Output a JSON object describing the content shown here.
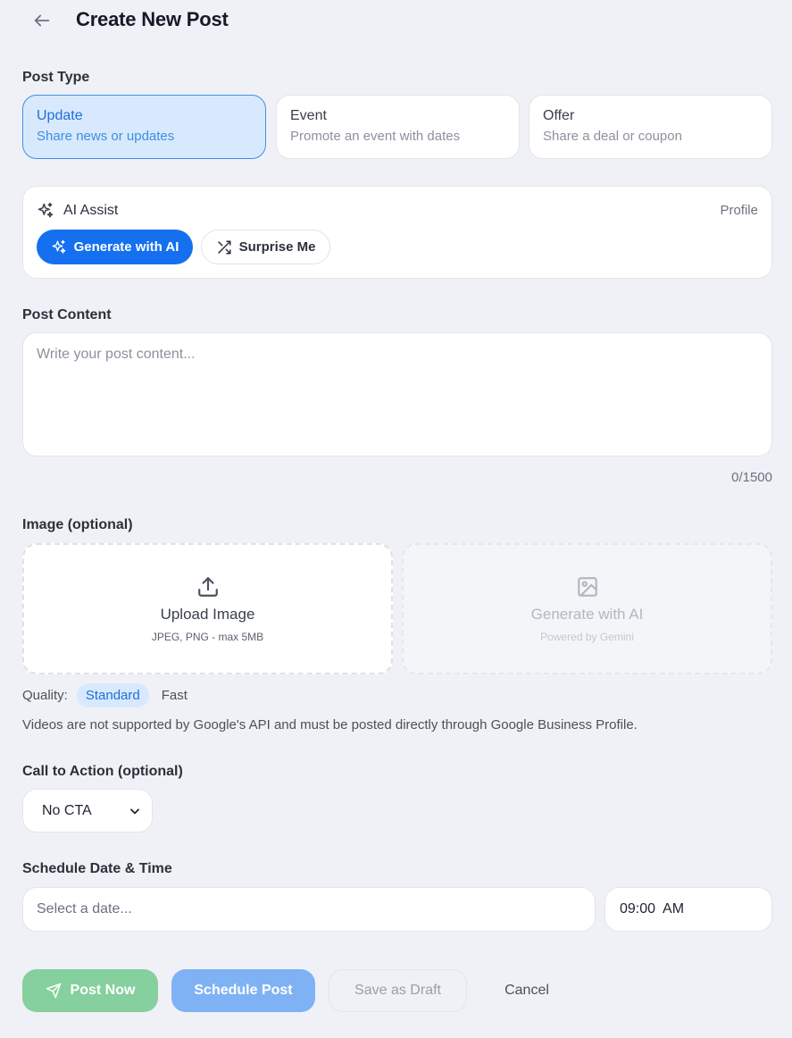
{
  "header": {
    "title": "Create New Post"
  },
  "post_type": {
    "label": "Post Type",
    "options": [
      {
        "title": "Update",
        "subtitle": "Share news or updates",
        "selected": true
      },
      {
        "title": "Event",
        "subtitle": "Promote an event with dates",
        "selected": false
      },
      {
        "title": "Offer",
        "subtitle": "Share a deal or coupon",
        "selected": false
      }
    ]
  },
  "ai_assist": {
    "title": "AI Assist",
    "profile_label": "Profile",
    "generate_label": "Generate with AI",
    "surprise_label": "Surprise Me"
  },
  "content": {
    "label": "Post Content",
    "placeholder": "Write your post content...",
    "value": "",
    "char_count": "0/1500"
  },
  "image": {
    "label": "Image (optional)",
    "upload": {
      "title": "Upload Image",
      "subtitle": "JPEG, PNG - max 5MB"
    },
    "generate": {
      "title": "Generate with AI",
      "subtitle": "Powered by Gemini",
      "disabled": true
    },
    "quality": {
      "label": "Quality:",
      "options": [
        "Standard",
        "Fast"
      ],
      "selected": "Standard"
    },
    "video_note": "Videos are not supported by Google's API and must be posted directly through Google Business Profile."
  },
  "cta": {
    "label": "Call to Action (optional)",
    "selected": "No CTA"
  },
  "schedule": {
    "label": "Schedule Date & Time",
    "date_placeholder": "Select a date...",
    "time_value": "09:00  AM"
  },
  "actions": {
    "post_now": "Post Now",
    "schedule": "Schedule Post",
    "draft": "Save as Draft",
    "cancel": "Cancel"
  },
  "colors": {
    "accent": "#1570ef",
    "selected_bg": "#d8e9fd",
    "post_now_bg": "#86cf9e",
    "schedule_bg": "#7fb2f5"
  }
}
